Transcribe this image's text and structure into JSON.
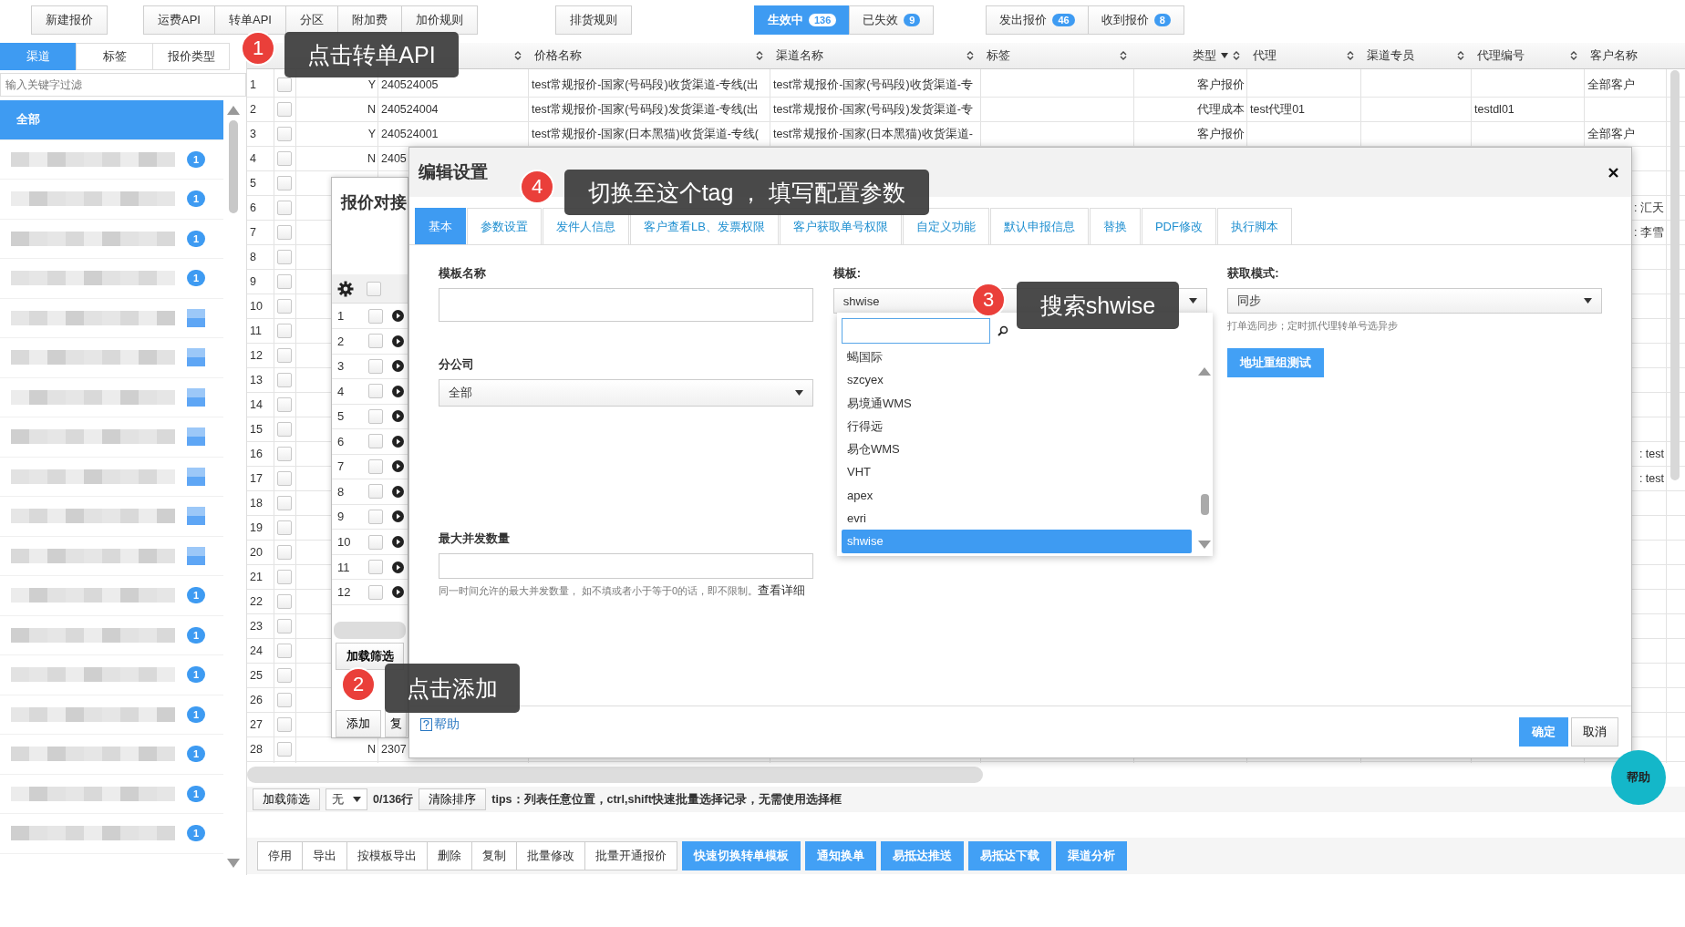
{
  "toolbar": {
    "button_groups": [
      [
        "新建报价"
      ],
      [
        "运费API",
        "转单API",
        "分区",
        "附加费",
        "加价规则"
      ],
      [
        "排货规则"
      ]
    ],
    "status_tabs": [
      {
        "label": "生效中",
        "count": "136",
        "selected": true
      },
      {
        "label": "已失效",
        "count": "9",
        "selected": false
      }
    ],
    "quote_tabs": [
      {
        "label": "发出报价",
        "count": "46"
      },
      {
        "label": "收到报价",
        "count": "8"
      }
    ]
  },
  "sidebar": {
    "tabs": [
      {
        "label": "渠道",
        "selected": true
      },
      {
        "label": "标签",
        "selected": false
      },
      {
        "label": "报价类型",
        "selected": false
      }
    ],
    "filter_placeholder": "输入关键字过滤",
    "items": [
      {
        "label": "全部",
        "selected": true
      },
      {
        "badge": "1",
        "selected": false
      },
      {
        "badge": "1",
        "selected": false
      },
      {
        "badge": "1",
        "selected": false
      },
      {
        "badge": "1",
        "selected": false
      },
      {
        "selected": false
      },
      {
        "selected": false
      },
      {
        "selected": false
      },
      {
        "selected": false
      },
      {
        "selected": false
      },
      {
        "selected": false
      },
      {
        "selected": false
      },
      {
        "badge": "1",
        "selected": false
      },
      {
        "badge": "1",
        "selected": false
      },
      {
        "badge": "1",
        "selected": false
      },
      {
        "badge": "1",
        "selected": false
      },
      {
        "badge": "1",
        "selected": false
      },
      {
        "badge": "1",
        "selected": false
      },
      {
        "badge": "1",
        "selected": false
      }
    ]
  },
  "table": {
    "columns": [
      "价格名称",
      "渠道名称",
      "标签",
      "类型",
      "代理",
      "渠道专员",
      "代理编号",
      "客户名称"
    ],
    "rows": [
      {
        "num": "1",
        "checked": false,
        "flag": "Y",
        "code": "240524005",
        "price_name": "test常规报价-国家(号码段)收货渠道-专线(出",
        "channel_name": "test常规报价-国家(号码段)收货渠道-专",
        "type": "客户报价",
        "customer": "全部客户"
      },
      {
        "num": "2",
        "checked": false,
        "flag": "N",
        "code": "240524004",
        "price_name": "test常规报价-国家(号码段)发货渠道-专线(出",
        "channel_name": "test常规报价-国家(号码段)发货渠道-专",
        "type": "代理成本",
        "agent": "test代理01",
        "agent_code": "testdl01"
      },
      {
        "num": "3",
        "checked": false,
        "flag": "Y",
        "code": "240524001",
        "price_name": "test常规报价-国家(日本黑猫)收货渠道-专线(",
        "channel_name": "test常规报价-国家(日本黑猫)收货渠道-",
        "type": "客户报价",
        "customer": "全部客户"
      },
      {
        "num": "4",
        "checked": false,
        "flag": "N",
        "code": "2405"
      },
      {
        "num": "5",
        "checked": false
      },
      {
        "num": "6",
        "checked": false,
        "customer": ": 汇天"
      },
      {
        "num": "7",
        "checked": false,
        "customer": ": 李雪"
      },
      {
        "num": "8",
        "checked": false
      },
      {
        "num": "9",
        "checked": false
      },
      {
        "num": "10",
        "checked": false
      },
      {
        "num": "11",
        "checked": false
      },
      {
        "num": "12",
        "checked": false
      },
      {
        "num": "13",
        "checked": false
      },
      {
        "num": "14",
        "checked": false
      },
      {
        "num": "15",
        "checked": false
      },
      {
        "num": "16",
        "checked": false,
        "customer": ": test"
      },
      {
        "num": "17",
        "checked": false,
        "customer": ": test"
      },
      {
        "num": "18",
        "checked": false
      },
      {
        "num": "19",
        "checked": false
      },
      {
        "num": "20",
        "checked": false
      },
      {
        "num": "21",
        "checked": false
      },
      {
        "num": "22",
        "checked": false
      },
      {
        "num": "23",
        "checked": false
      },
      {
        "num": "24",
        "checked": false
      },
      {
        "num": "25",
        "checked": false
      },
      {
        "num": "26",
        "checked": false
      },
      {
        "num": "27",
        "checked": false
      },
      {
        "num": "28",
        "checked": false,
        "flag": "N",
        "code": "2307"
      }
    ]
  },
  "pager": {
    "load_filter": "加载筛选",
    "select_value": "无",
    "count": "0/136行",
    "clear_sort": "清除排序",
    "tips": "tips：列表任意位置，ctrl,shift快速批量选择记录，无需使用选择框"
  },
  "actions": [
    {
      "label": "停用",
      "kind": "plain"
    },
    {
      "label": "导出",
      "kind": "plain"
    },
    {
      "label": "按模板导出",
      "kind": "plain"
    },
    {
      "label": "删除",
      "kind": "plain"
    },
    {
      "label": "复制",
      "kind": "plain"
    },
    {
      "label": "批量修改",
      "kind": "plain"
    },
    {
      "label": "批量开通报价",
      "kind": "plain"
    },
    {
      "label": "快速切换转单模板",
      "kind": "primary"
    },
    {
      "label": "通知换单",
      "kind": "primary"
    },
    {
      "label": "易抵达推送",
      "kind": "primary"
    },
    {
      "label": "易抵达下载",
      "kind": "primary"
    },
    {
      "label": "渠道分析",
      "kind": "primary"
    }
  ],
  "quote_dialog": {
    "title": "报价对接",
    "all_checked": false,
    "rows": [
      {
        "num": "1",
        "checked": false
      },
      {
        "num": "2",
        "checked": false
      },
      {
        "num": "3",
        "checked": false
      },
      {
        "num": "4",
        "checked": false
      },
      {
        "num": "5",
        "checked": false
      },
      {
        "num": "6",
        "checked": false
      },
      {
        "num": "7",
        "checked": false
      },
      {
        "num": "8",
        "checked": false
      },
      {
        "num": "9",
        "checked": false
      },
      {
        "num": "10",
        "checked": false
      },
      {
        "num": "11",
        "checked": false
      },
      {
        "num": "12",
        "checked": false
      }
    ],
    "load_filter": "加载筛选",
    "add": "添加",
    "copy": "复"
  },
  "edit_dialog": {
    "title": "编辑设置",
    "tabs": [
      {
        "label": "基本",
        "selected": true
      },
      {
        "label": "参数设置",
        "selected": false
      },
      {
        "label": "发件人信息",
        "selected": false
      },
      {
        "label": "客户查看LB、发票权限",
        "selected": false
      },
      {
        "label": "客户获取单号权限",
        "selected": false
      },
      {
        "label": "自定义功能",
        "selected": false
      },
      {
        "label": "默认申报信息",
        "selected": false
      },
      {
        "label": "替换",
        "selected": false
      },
      {
        "label": "PDF修改",
        "selected": false
      },
      {
        "label": "执行脚本",
        "selected": false
      }
    ],
    "template_name": {
      "label": "模板名称"
    },
    "branch": {
      "label": "分公司",
      "value": "全部"
    },
    "max_concurrency": {
      "label": "最大并发数量",
      "hint": "同一时间允许的最大并发数量， 如不填或者小于等于0的话，即不限制。",
      "link": "查看详细"
    },
    "template": {
      "label": "模板:",
      "value": "shwise",
      "options": [
        {
          "label": "蝎国际",
          "selected": false
        },
        {
          "label": "szcyex",
          "selected": false
        },
        {
          "label": "易境通WMS",
          "selected": false
        },
        {
          "label": "行得远",
          "selected": false
        },
        {
          "label": "易仓WMS",
          "selected": false
        },
        {
          "label": "VHT",
          "selected": false
        },
        {
          "label": "apex",
          "selected": false
        },
        {
          "label": "evri",
          "selected": false
        },
        {
          "label": "shwise",
          "selected": true
        }
      ]
    },
    "fetch_mode": {
      "label": "获取模式:",
      "value": "同步",
      "hint": "打单选同步；定时抓代理转单号选异步"
    },
    "test_button": "地址重组测试",
    "help": "帮助",
    "ok": "确定",
    "cancel": "取消"
  },
  "callouts": [
    {
      "number": "1",
      "text": "点击转单API"
    },
    {
      "number": "2",
      "text": "点击添加"
    },
    {
      "number": "3",
      "text": "搜索shwise"
    },
    {
      "number": "4",
      "text": "切换至这个tag ， 填写配置参数"
    }
  ],
  "help_button": "帮助"
}
